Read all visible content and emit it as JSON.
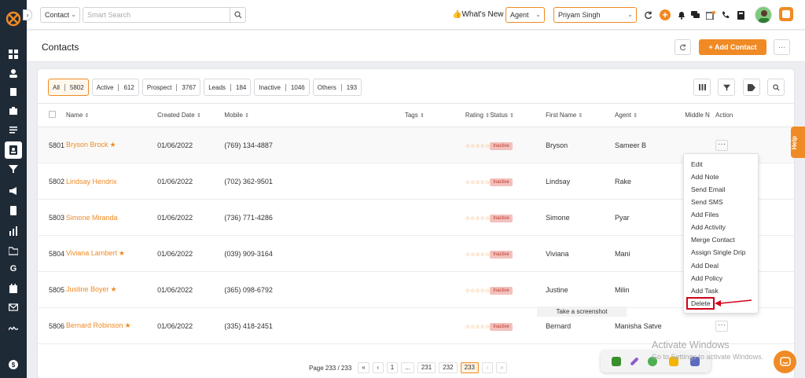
{
  "colors": {
    "accent": "#f08a24",
    "sidebar": "#1f2a37",
    "danger": "#d0021b"
  },
  "topbar": {
    "entity_select": "Contact",
    "search_placeholder": "Smart Search",
    "whats_new": "What's New",
    "role_select": "Agent",
    "user_select": "Priyam Singh"
  },
  "header": {
    "title": "Contacts",
    "add_button": "Add Contact"
  },
  "filters": [
    {
      "label": "All",
      "count": "5802"
    },
    {
      "label": "Active",
      "count": "612"
    },
    {
      "label": "Prospect",
      "count": "3767"
    },
    {
      "label": "Leads",
      "count": "184"
    },
    {
      "label": "Inactive",
      "count": "1046"
    },
    {
      "label": "Others",
      "count": "193"
    }
  ],
  "columns": {
    "name": "Name",
    "created": "Created Date",
    "mobile": "Mobile",
    "tags": "Tags",
    "rating": "Rating",
    "status": "Status",
    "first": "First Name",
    "agent": "Agent",
    "middle": "Middle N",
    "action": "Action"
  },
  "rows": [
    {
      "id": "5801",
      "name": "Bryson Brock",
      "created": "01/06/2022",
      "mobile": "(769) 134-4887",
      "rating": "☆☆☆☆☆",
      "status": "Inactive",
      "first": "Bryson",
      "agent": "Sameer B"
    },
    {
      "id": "5802",
      "name": "Lindsay Hendrix",
      "created": "01/06/2022",
      "mobile": "(702) 362-9501",
      "rating": "☆☆☆☆☆",
      "status": "Inactive",
      "first": "Lindsay",
      "agent": "Rake"
    },
    {
      "id": "5803",
      "name": "Simone Miranda",
      "created": "01/06/2022",
      "mobile": "(736) 771-4286",
      "rating": "☆☆☆☆☆",
      "status": "Inactive",
      "first": "Simone",
      "agent": "Pyar"
    },
    {
      "id": "5804",
      "name": "Viviana Lambert",
      "created": "01/06/2022",
      "mobile": "(039) 909-3164",
      "rating": "☆☆☆☆☆",
      "status": "Inactive",
      "first": "Viviana",
      "agent": "Mani"
    },
    {
      "id": "5805",
      "name": "Justine Boyer",
      "created": "01/06/2022",
      "mobile": "(365) 098-6792",
      "rating": "☆☆☆☆☆",
      "status": "Inactive",
      "first": "Justine",
      "agent": "Milin"
    },
    {
      "id": "5806",
      "name": "Bernard Robinson",
      "created": "01/06/2022",
      "mobile": "(335) 418-2451",
      "rating": "☆☆☆☆☆",
      "status": "Inactive",
      "first": "Bernard",
      "agent": "Manisha Satve"
    }
  ],
  "action_menu": [
    "Edit",
    "Add Note",
    "Send Email",
    "Send SMS",
    "Add Files",
    "Add Activity",
    "Merge Contact",
    "Assign Single Drip",
    "Add Deal",
    "Add Policy",
    "Add Task",
    "Delete"
  ],
  "tooltip": "Take a screenshot",
  "pager": {
    "label": "Page 233 / 233",
    "first": "«",
    "prev": "‹",
    "p1": "1",
    "ellipsis": "...",
    "p231": "231",
    "p232": "232",
    "p233": "233",
    "next": "›",
    "last": "»"
  },
  "help": "Help",
  "watermark": {
    "line1": "Activate Windows",
    "line2": "Go to Settings to activate Windows."
  }
}
